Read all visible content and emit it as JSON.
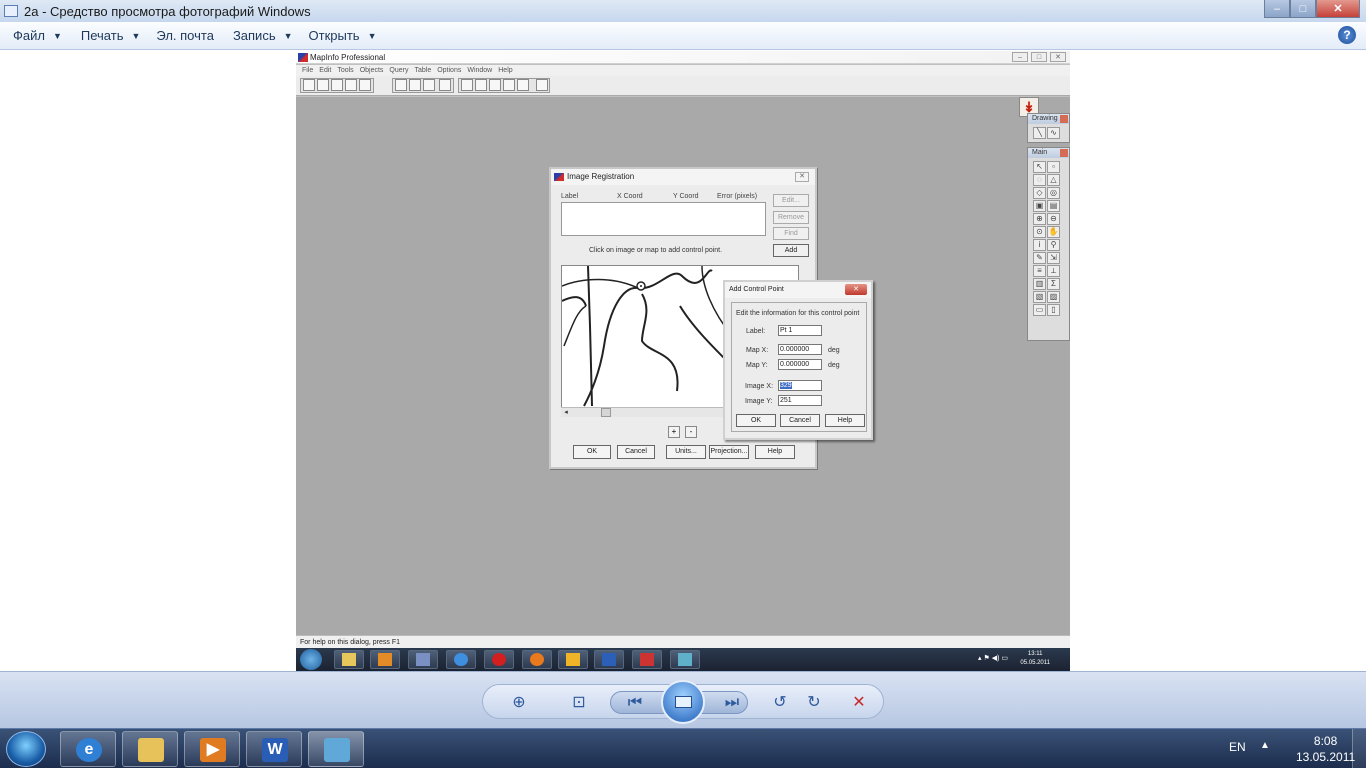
{
  "window": {
    "title": "2a - Средство просмотра фотографий Windows",
    "min": "–",
    "max": "□",
    "close": "✕"
  },
  "menu": {
    "items": [
      {
        "label": "Файл",
        "dropdown": true
      },
      {
        "label": "Печать",
        "dropdown": true
      },
      {
        "label": "Эл. почта",
        "dropdown": false
      },
      {
        "label": "Запись",
        "dropdown": true
      },
      {
        "label": "Открыть",
        "dropdown": true
      }
    ],
    "help": "?"
  },
  "screenshot": {
    "app_title": "MapInfo Professional",
    "menu": [
      "File",
      "Edit",
      "Tools",
      "Objects",
      "Query",
      "Table",
      "Options",
      "Window",
      "Help"
    ],
    "palettes": {
      "drawing": "Drawing",
      "main": "Main",
      "sigma": "Σ"
    },
    "image_registration": {
      "title": "Image Registration",
      "columns": [
        "Label",
        "X Coord",
        "Y Coord",
        "Error (pixels)"
      ],
      "side_buttons": [
        {
          "label": "Edit...",
          "enabled": false
        },
        {
          "label": "Remove",
          "enabled": false
        },
        {
          "label": "Find",
          "enabled": false
        },
        {
          "label": "Add",
          "enabled": true
        }
      ],
      "hint": "Click on image or map to add control point.",
      "zoom_in": "+",
      "zoom_out": "-",
      "buttons": [
        "OK",
        "Cancel",
        "Units...",
        "Projection...",
        "Help"
      ]
    },
    "add_control_point": {
      "title": "Add Control Point",
      "instruction": "Edit the information for this control point",
      "label_caption": "Label:",
      "label_value": "Pt 1",
      "mapx_caption": "Map X:",
      "mapx_value": "0.000000",
      "mapy_caption": "Map Y:",
      "mapy_value": "0.000000",
      "unit": "deg",
      "imagex_caption": "Image X:",
      "imagex_value": "329",
      "imagey_caption": "Image Y:",
      "imagey_value": "251",
      "buttons": [
        "OK",
        "Cancel",
        "Help"
      ]
    },
    "status": "For help on this dialog, press F1",
    "tray_clock": {
      "time": "13:11",
      "date": "05.05.2011"
    }
  },
  "taskbar": {
    "lang": "EN",
    "time": "8:08",
    "date": "13.05.2011"
  },
  "colors": {
    "accent": "#1e5d9a",
    "close_red": "#c5413a",
    "desk_gray": "#a9a9a9"
  }
}
